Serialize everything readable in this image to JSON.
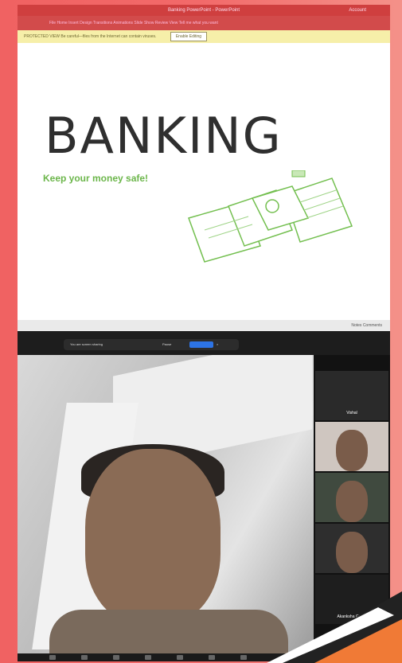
{
  "window": {
    "title": "Banking PowerPoint - PowerPoint",
    "user": "Account"
  },
  "ribbon": {
    "menu": "File  Home  Insert  Design  Transitions  Animations  Slide Show  Review  View  Tell me what you want"
  },
  "protected_bar": {
    "message": "PROTECTED VIEW  Be careful—files from the Internet can contain viruses.",
    "button": "Enable Editing"
  },
  "slide": {
    "title": "BANKING",
    "subtitle": "Keep your money safe!"
  },
  "statusbar": {
    "text": "Notes  Comments"
  },
  "zoom_share": {
    "message": "You are screen sharing",
    "pause_label": "Pause",
    "stop_label": "Stop Share",
    "close_icon": "close-icon"
  },
  "participants": [
    {
      "name": "Vishal"
    },
    {
      "name": ""
    },
    {
      "name": ""
    },
    {
      "name": ""
    },
    {
      "name": "Akanksha Gupta"
    }
  ],
  "colors": {
    "accent": "#ef5b5b",
    "subtitle_green": "#6cb64b",
    "zoom_blue": "#2d74e6"
  }
}
